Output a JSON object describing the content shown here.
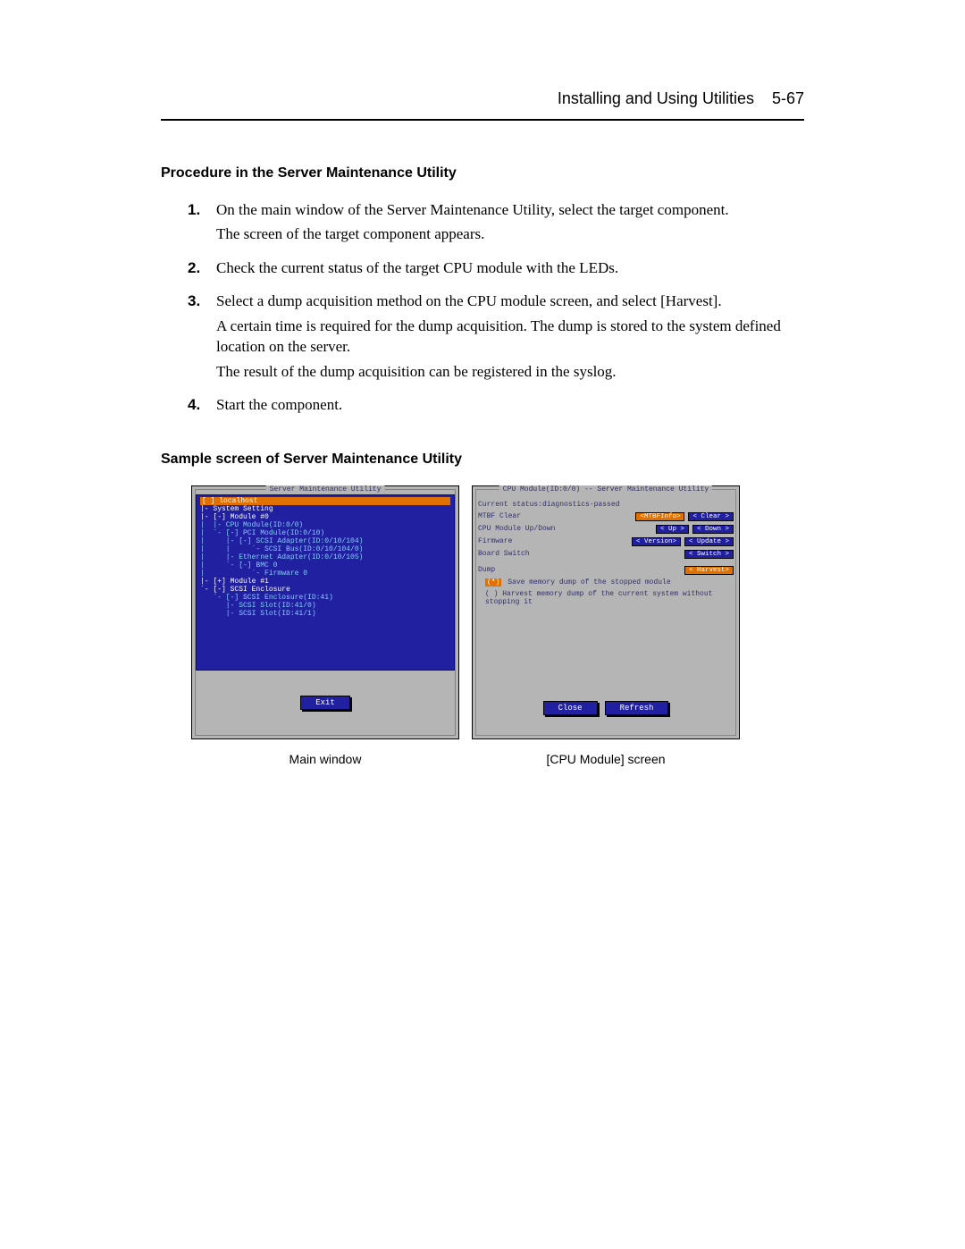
{
  "header": {
    "title": "Installing and Using Utilities",
    "page_number": "5-67"
  },
  "section1": {
    "title": "Procedure in the Server Maintenance Utility",
    "steps": [
      {
        "num": "1.",
        "paras": [
          "On the main window of the Server Maintenance Utility, select the target component.",
          "The screen of the target component appears."
        ]
      },
      {
        "num": "2.",
        "paras": [
          "Check the current status of the target CPU module with the LEDs."
        ]
      },
      {
        "num": "3.",
        "paras": [
          "Select a dump acquisition method on the CPU module screen, and select [Harvest].",
          "A certain time is required for the dump acquisition. The dump is stored to the system defined location on the server.",
          "The result of the dump acquisition can be registered in the syslog."
        ]
      },
      {
        "num": "4.",
        "paras": [
          "Start the component."
        ]
      }
    ]
  },
  "section2": {
    "title": "Sample screen of Server Maintenance Utility"
  },
  "main_window": {
    "frame_title": "Server Maintenance Utility",
    "selected": "[ ] localhost",
    "tree": [
      "|- System Setting",
      "|- [-] Module #0",
      "|  |- CPU Module(ID:0/0)",
      "|  `- [-] PCI Module(ID:0/10)",
      "|     |- [-] SCSI Adapter(ID:0/10/104)",
      "|     |     `- SCSI Bus(ID:0/10/104/0)",
      "|     |- Ethernet Adapter(ID:0/10/105)",
      "|     `- [-] BMC 0",
      "|           `- Firmware 0",
      "|- [+] Module #1",
      "`- [-] SCSI Enclosure",
      "   `- [-] SCSI Enclosure(ID:41)",
      "      |- SCSI Slot(ID:41/0)",
      "      |- SCSI Slot(ID:41/1)"
    ],
    "exit_button": "Exit",
    "caption": "Main window"
  },
  "cpu_screen": {
    "frame_title": "CPU Module(ID:0/0) -- Server Maintenance Utility",
    "status_line": "Current status:diagnostics-passed",
    "rows": [
      {
        "label": "MTBF Clear",
        "buttons": [
          "<MTBFInfo>",
          "<  Clear >"
        ],
        "selected_button": 0
      },
      {
        "label": "CPU Module Up/Down",
        "buttons": [
          "<   Up   >",
          "<  Down  >"
        ]
      },
      {
        "label": "Firmware",
        "buttons": [
          "< Version>",
          "< Update >"
        ]
      },
      {
        "label": "Board Switch",
        "buttons": [
          "< Switch >"
        ]
      },
      {
        "label": "Dump",
        "buttons": [
          "< Harvest>"
        ],
        "selected_button": 0
      }
    ],
    "radios": [
      {
        "selected": true,
        "text": "Save memory dump of the stopped module"
      },
      {
        "selected": false,
        "text": "Harvest memory dump of the current system without stopping it"
      }
    ],
    "close_button": "Close",
    "refresh_button": "Refresh",
    "caption": "[CPU Module] screen"
  }
}
